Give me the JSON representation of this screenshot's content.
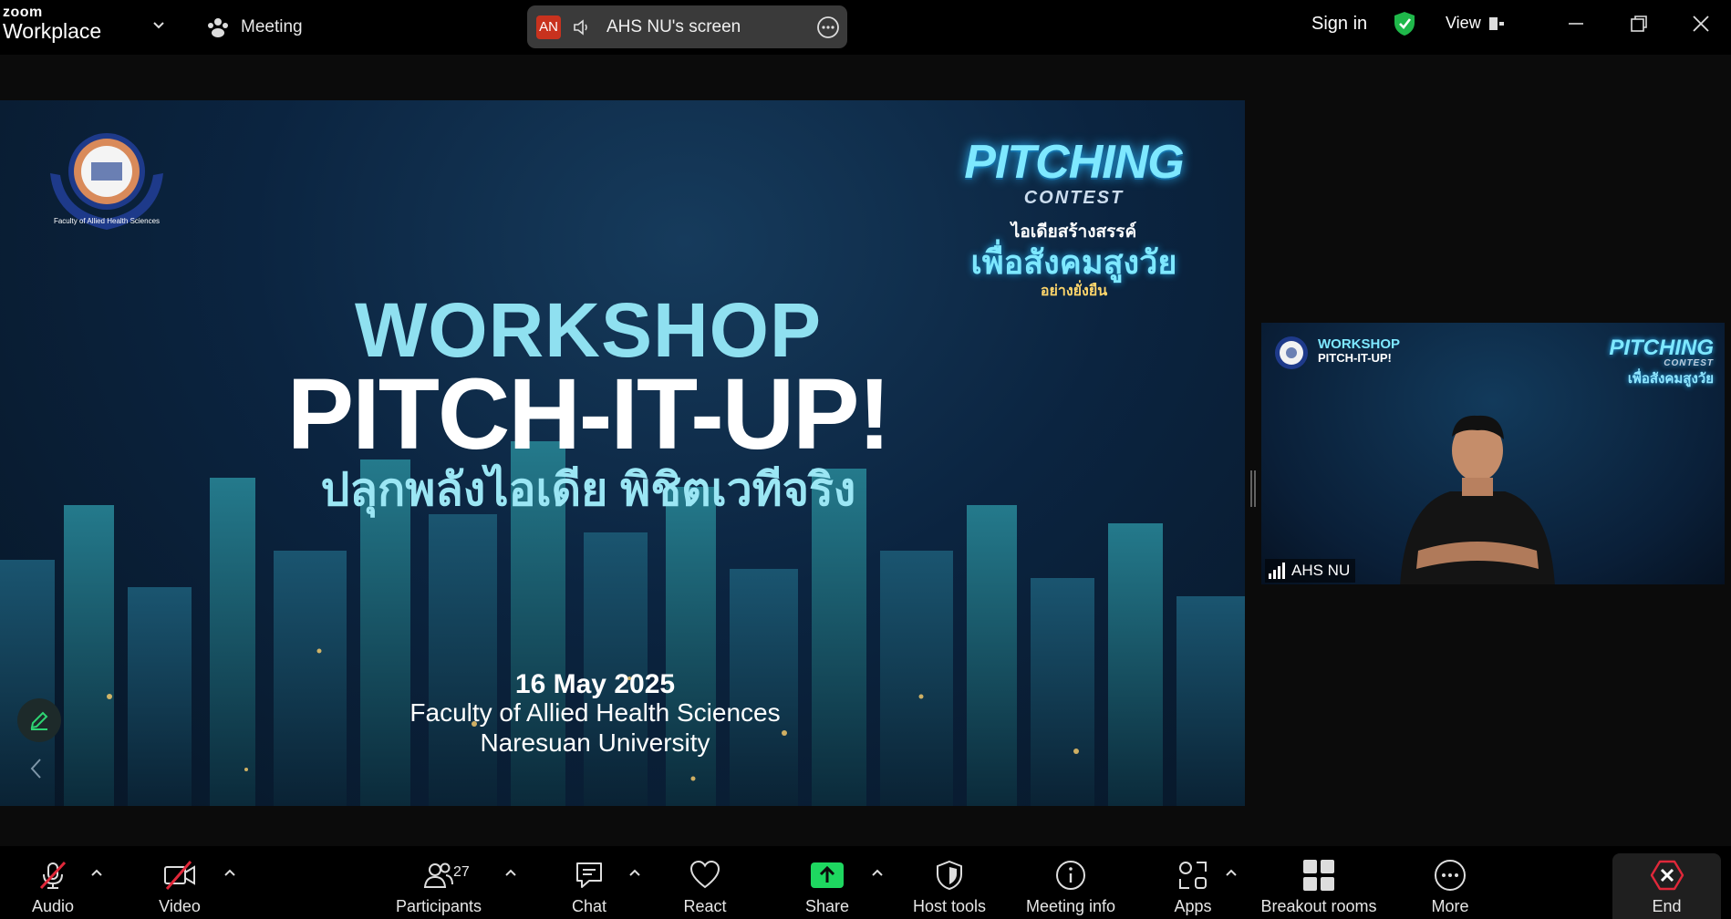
{
  "app": {
    "logo_small": "zoom",
    "logo_big": "Workplace",
    "meeting_label": "Meeting",
    "screen_share": {
      "badge": "AN",
      "label": "AHS NU's screen"
    },
    "sign_in": "Sign in",
    "view": "View"
  },
  "slide": {
    "line1": "WORKSHOP",
    "line2": "PITCH-IT-UP!",
    "line3": "ปลุกพลังไอเดีย พิชิตเวทีจริง",
    "date": "16 May 2025",
    "faculty": "Faculty of Allied Health Sciences",
    "university": "Naresuan University",
    "seal_text": "Faculty of Allied Health Sciences",
    "pitching": {
      "title": "PITCHING",
      "subtitle": "CONTEST",
      "thai1": "ไอเดียสร้างสรรค์",
      "thai2": "เพื่อสังคมสูงวัย",
      "thai3": "อย่างยั่งยืน"
    }
  },
  "video_tile": {
    "name": "AHS NU",
    "thumb_ws": "WORKSHOP",
    "thumb_pitch": "PITCH-IT-UP!",
    "thumb_pitching": "PITCHING",
    "thumb_contest": "CONTEST",
    "thumb_thai": "เพื่อสังคมสูงวัย"
  },
  "toolbar": {
    "audio": "Audio",
    "video": "Video",
    "participants": "Participants",
    "participants_count": "27",
    "chat": "Chat",
    "react": "React",
    "share": "Share",
    "host_tools": "Host tools",
    "meeting_info": "Meeting info",
    "apps": "Apps",
    "breakout_rooms": "Breakout rooms",
    "more": "More",
    "end": "End"
  },
  "colors": {
    "share_green": "#1ed760",
    "end_red": "#e0283a",
    "shield_green": "#1fb84a",
    "mute_red": "#e0283a"
  }
}
